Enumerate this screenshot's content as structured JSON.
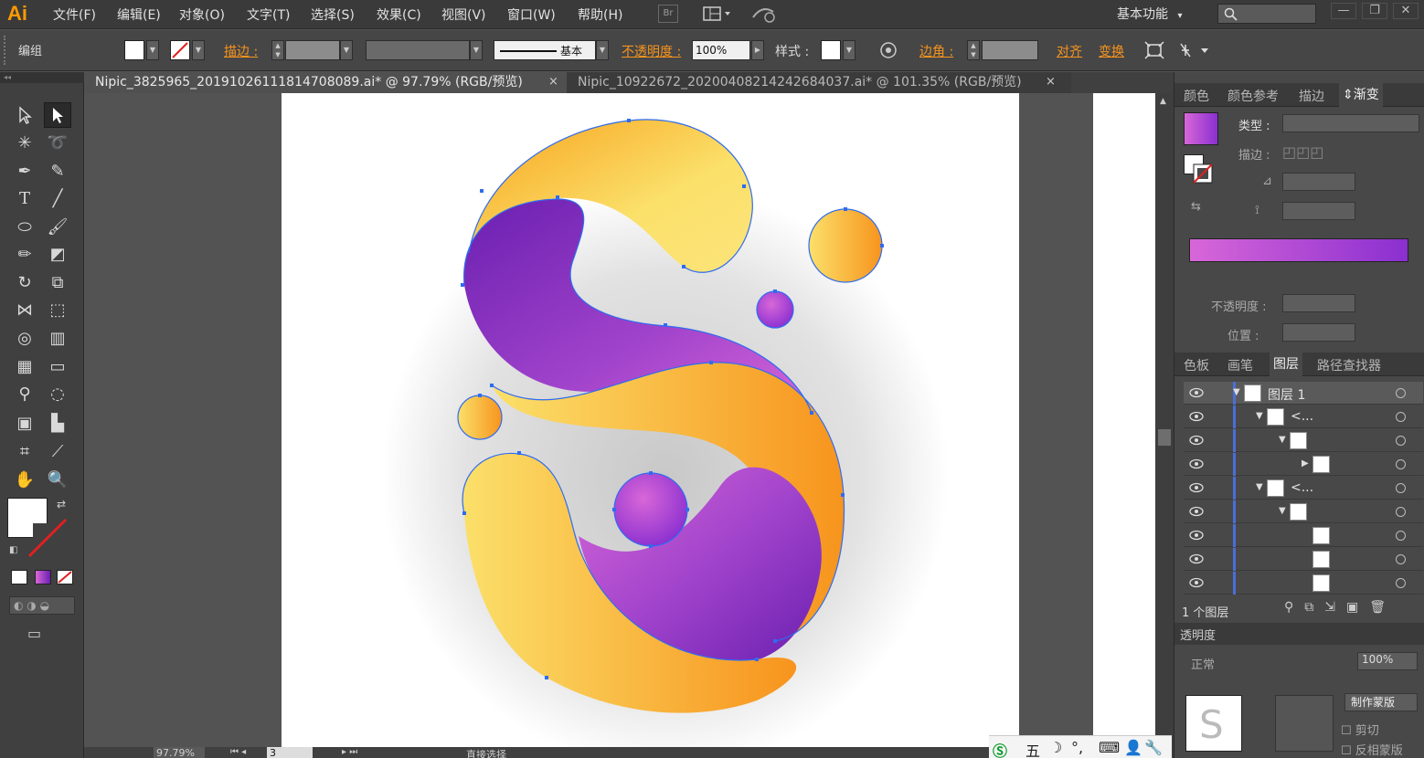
{
  "app": {
    "logo": "Ai"
  },
  "menu": [
    "文件(F)",
    "编辑(E)",
    "对象(O)",
    "文字(T)",
    "选择(S)",
    "效果(C)",
    "视图(V)",
    "窗口(W)",
    "帮助(H)"
  ],
  "menubar": {
    "br_label": "Br",
    "workspace": "基本功能",
    "workspace_arrow": "▾"
  },
  "controlbar": {
    "selection_label": "编组",
    "stroke_label": "描边 :",
    "stroke_style": "基本",
    "opacity_label": "不透明度 :",
    "opacity_value": "100%",
    "style_label": "样式 :",
    "corner_label": "边角 :",
    "align_label": "对齐",
    "transform_label": "变换"
  },
  "tabs": [
    {
      "title": "Nipic_3825965_20191026111814708089.ai* @ 97.79% (RGB/预览)",
      "active": true
    },
    {
      "title": "Nipic_10922672_20200408214242684037.ai* @ 101.35% (RGB/预览)",
      "active": false
    }
  ],
  "tab_close": "×",
  "gradient_panel": {
    "tabs": [
      "颜色",
      "颜色参考",
      "描边",
      "渐变"
    ],
    "active_tab": "渐变",
    "type_label": "类型 :",
    "stroke_label": "描边 :",
    "opacity_label": "不透明度 :",
    "position_label": "位置 :",
    "gradient_start": "#d867d8",
    "gradient_end": "#8a2fd0"
  },
  "layers_panel": {
    "tabs": [
      "色板",
      "画笔",
      "图层",
      "路径查找器"
    ],
    "active_tab": "图层",
    "rows": [
      {
        "name": "图层 1",
        "level": 0,
        "expanded": true
      },
      {
        "name": "<...",
        "level": 1,
        "expanded": true
      },
      {
        "name": "",
        "level": 2,
        "expanded": true
      },
      {
        "name": "",
        "level": 3,
        "expanded": false
      },
      {
        "name": "<...",
        "level": 1,
        "expanded": true
      },
      {
        "name": "",
        "level": 2,
        "expanded": true
      },
      {
        "name": "",
        "level": 3,
        "expanded": null
      },
      {
        "name": "",
        "level": 3,
        "expanded": null
      },
      {
        "name": "",
        "level": 3,
        "expanded": null
      }
    ],
    "footer": "1 个图层"
  },
  "transparency_panel": {
    "title": "透明度",
    "mode": "正常",
    "opacity": "100%",
    "make_mask": "制作蒙版",
    "clip": "剪切",
    "invert_mask": "反相蒙版"
  },
  "status": {
    "zoom": "97.79%",
    "page": "3",
    "tool": "直接选择"
  },
  "ime": {
    "label": "五"
  },
  "colors": {
    "yellow": "#fbe06a",
    "orange": "#f7941d",
    "purple_dark": "#6a1fb0",
    "purple_light": "#c95ad6",
    "anchor_blue": "#2f6cf0"
  }
}
